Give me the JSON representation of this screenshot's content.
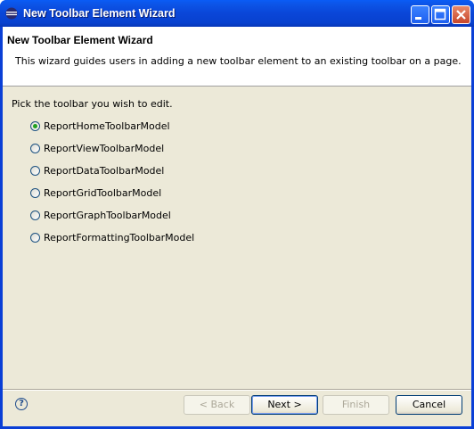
{
  "window": {
    "title": "New Toolbar Element Wizard"
  },
  "banner": {
    "title": "New Toolbar Element Wizard",
    "description": "This wizard guides users in adding a new toolbar element to an existing toolbar on a page."
  },
  "content": {
    "prompt": "Pick the toolbar you wish to edit.",
    "options": [
      {
        "label": "ReportHomeToolbarModel",
        "checked": true
      },
      {
        "label": "ReportViewToolbarModel",
        "checked": false
      },
      {
        "label": "ReportDataToolbarModel",
        "checked": false
      },
      {
        "label": "ReportGridToolbarModel",
        "checked": false
      },
      {
        "label": "ReportGraphToolbarModel",
        "checked": false
      },
      {
        "label": "ReportFormattingToolbarModel",
        "checked": false
      }
    ]
  },
  "footer": {
    "help_icon": "question-mark-icon",
    "back_label": "< Back",
    "next_label": "Next >",
    "finish_label": "Finish",
    "cancel_label": "Cancel"
  }
}
